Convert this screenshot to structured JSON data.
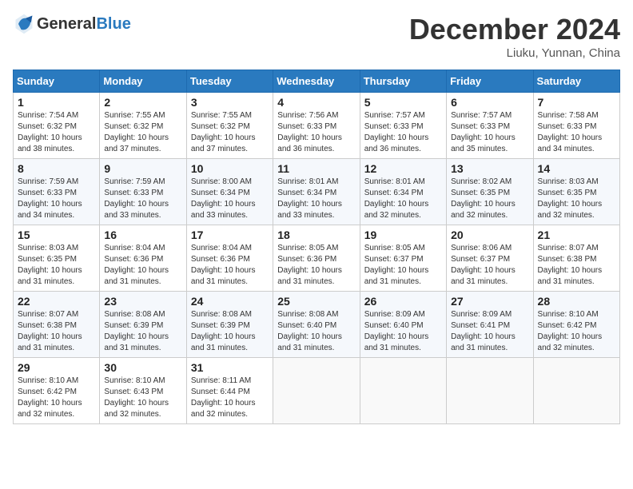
{
  "header": {
    "logo_line1": "General",
    "logo_line2": "Blue",
    "month_title": "December 2024",
    "location": "Liuku, Yunnan, China"
  },
  "weekdays": [
    "Sunday",
    "Monday",
    "Tuesday",
    "Wednesday",
    "Thursday",
    "Friday",
    "Saturday"
  ],
  "weeks": [
    [
      {
        "day": "1",
        "sunrise": "7:54 AM",
        "sunset": "6:32 PM",
        "daylight": "10 hours and 38 minutes."
      },
      {
        "day": "2",
        "sunrise": "7:55 AM",
        "sunset": "6:32 PM",
        "daylight": "10 hours and 37 minutes."
      },
      {
        "day": "3",
        "sunrise": "7:55 AM",
        "sunset": "6:32 PM",
        "daylight": "10 hours and 37 minutes."
      },
      {
        "day": "4",
        "sunrise": "7:56 AM",
        "sunset": "6:33 PM",
        "daylight": "10 hours and 36 minutes."
      },
      {
        "day": "5",
        "sunrise": "7:57 AM",
        "sunset": "6:33 PM",
        "daylight": "10 hours and 36 minutes."
      },
      {
        "day": "6",
        "sunrise": "7:57 AM",
        "sunset": "6:33 PM",
        "daylight": "10 hours and 35 minutes."
      },
      {
        "day": "7",
        "sunrise": "7:58 AM",
        "sunset": "6:33 PM",
        "daylight": "10 hours and 34 minutes."
      }
    ],
    [
      {
        "day": "8",
        "sunrise": "7:59 AM",
        "sunset": "6:33 PM",
        "daylight": "10 hours and 34 minutes."
      },
      {
        "day": "9",
        "sunrise": "7:59 AM",
        "sunset": "6:33 PM",
        "daylight": "10 hours and 33 minutes."
      },
      {
        "day": "10",
        "sunrise": "8:00 AM",
        "sunset": "6:34 PM",
        "daylight": "10 hours and 33 minutes."
      },
      {
        "day": "11",
        "sunrise": "8:01 AM",
        "sunset": "6:34 PM",
        "daylight": "10 hours and 33 minutes."
      },
      {
        "day": "12",
        "sunrise": "8:01 AM",
        "sunset": "6:34 PM",
        "daylight": "10 hours and 32 minutes."
      },
      {
        "day": "13",
        "sunrise": "8:02 AM",
        "sunset": "6:35 PM",
        "daylight": "10 hours and 32 minutes."
      },
      {
        "day": "14",
        "sunrise": "8:03 AM",
        "sunset": "6:35 PM",
        "daylight": "10 hours and 32 minutes."
      }
    ],
    [
      {
        "day": "15",
        "sunrise": "8:03 AM",
        "sunset": "6:35 PM",
        "daylight": "10 hours and 31 minutes."
      },
      {
        "day": "16",
        "sunrise": "8:04 AM",
        "sunset": "6:36 PM",
        "daylight": "10 hours and 31 minutes."
      },
      {
        "day": "17",
        "sunrise": "8:04 AM",
        "sunset": "6:36 PM",
        "daylight": "10 hours and 31 minutes."
      },
      {
        "day": "18",
        "sunrise": "8:05 AM",
        "sunset": "6:36 PM",
        "daylight": "10 hours and 31 minutes."
      },
      {
        "day": "19",
        "sunrise": "8:05 AM",
        "sunset": "6:37 PM",
        "daylight": "10 hours and 31 minutes."
      },
      {
        "day": "20",
        "sunrise": "8:06 AM",
        "sunset": "6:37 PM",
        "daylight": "10 hours and 31 minutes."
      },
      {
        "day": "21",
        "sunrise": "8:07 AM",
        "sunset": "6:38 PM",
        "daylight": "10 hours and 31 minutes."
      }
    ],
    [
      {
        "day": "22",
        "sunrise": "8:07 AM",
        "sunset": "6:38 PM",
        "daylight": "10 hours and 31 minutes."
      },
      {
        "day": "23",
        "sunrise": "8:08 AM",
        "sunset": "6:39 PM",
        "daylight": "10 hours and 31 minutes."
      },
      {
        "day": "24",
        "sunrise": "8:08 AM",
        "sunset": "6:39 PM",
        "daylight": "10 hours and 31 minutes."
      },
      {
        "day": "25",
        "sunrise": "8:08 AM",
        "sunset": "6:40 PM",
        "daylight": "10 hours and 31 minutes."
      },
      {
        "day": "26",
        "sunrise": "8:09 AM",
        "sunset": "6:40 PM",
        "daylight": "10 hours and 31 minutes."
      },
      {
        "day": "27",
        "sunrise": "8:09 AM",
        "sunset": "6:41 PM",
        "daylight": "10 hours and 31 minutes."
      },
      {
        "day": "28",
        "sunrise": "8:10 AM",
        "sunset": "6:42 PM",
        "daylight": "10 hours and 32 minutes."
      }
    ],
    [
      {
        "day": "29",
        "sunrise": "8:10 AM",
        "sunset": "6:42 PM",
        "daylight": "10 hours and 32 minutes."
      },
      {
        "day": "30",
        "sunrise": "8:10 AM",
        "sunset": "6:43 PM",
        "daylight": "10 hours and 32 minutes."
      },
      {
        "day": "31",
        "sunrise": "8:11 AM",
        "sunset": "6:44 PM",
        "daylight": "10 hours and 32 minutes."
      },
      null,
      null,
      null,
      null
    ]
  ]
}
